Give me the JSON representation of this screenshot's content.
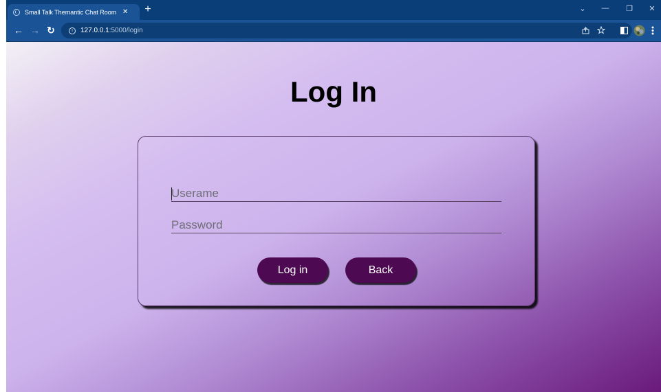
{
  "browser": {
    "tab_title": "Small Talk Themantic Chat Room",
    "tab_close": "✕",
    "new_tab": "+",
    "url_host": "127.0.0.1",
    "url_path": ":5000/login",
    "window_controls": {
      "dropdown": "⌄",
      "minimize": "—",
      "restore": "❐",
      "close": "✕"
    },
    "nav": {
      "back": "←",
      "forward": "→",
      "reload": "↻"
    },
    "icons": [
      "info-icon",
      "share-icon",
      "star-icon",
      "side-panel-icon",
      "profile-avatar",
      "menu-icon"
    ]
  },
  "page": {
    "title": "Log In",
    "username_placeholder": "Userame",
    "password_placeholder": "Password",
    "login_label": "Log in",
    "back_label": "Back"
  },
  "colors": {
    "titlebar": "#0a3e78",
    "toolbar": "#1a5496",
    "button": "#4d0a52",
    "gradient_start": "#f3f0f5",
    "gradient_mid": "#cdb3ec",
    "gradient_end": "#6a1a7a"
  }
}
